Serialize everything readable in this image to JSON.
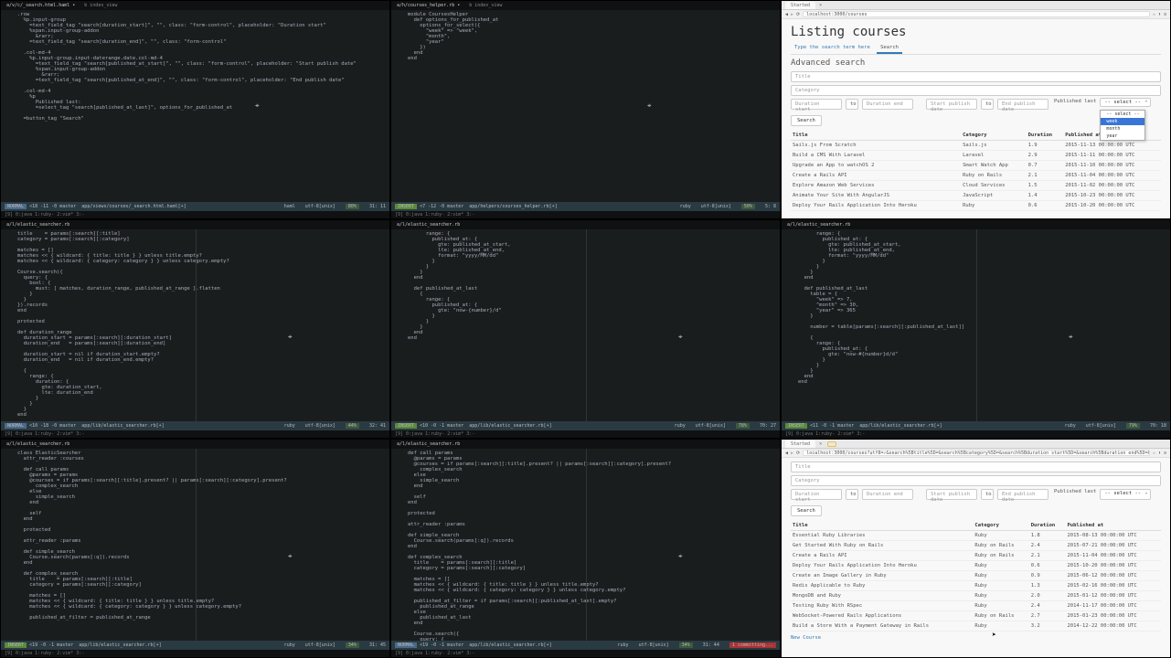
{
  "panes": {
    "p1": {
      "tabs": [
        "a/v/c/_search.html.haml •",
        "b index_view"
      ],
      "tabs_right": [
        "a/h/courses_helper.rb •",
        "b index_view"
      ],
      "code_left": ".row\n  %p.input-group\n    =text_field_tag \"search[duration_start]\", \"\", class: \"form-control\", placeholder: \"Duration start\"\n    %span.input-group-addon\n      &rarr;\n    =text_field_tag \"search[duration_end]\", \"\", class: \"form-control\"\n\n  .col-md-4\n    %p.input-group.input-daterange.date.col-md-4\n      =text_field_tag \"search[published_at_start]\", \"\", class: \"form-control\", placeholder: \"Start publish date\"\n      %span.input-group-addon\n        &rarr;\n      =text_field_tag \"search[published_at_end]\", \"\", class: \"form-control\", placeholder: \"End publish date\"\n\n  .col-md-4\n    %p\n      Published last:\n      =select_tag \"search[published_at_last]\", options_for_published_at\n\n  =button_tag \"Search\"",
      "code_right": "module CoursesHelper\n  def options_for_published_at\n    options_for_select({\n      \"week\" => \"week\",\n      \"month\",\n      \"year\"\n    })\n  end\nend",
      "status_left": {
        "mode": "NORMAL",
        "branch": "<18 -11 -0 master",
        "file": "app/views/courses/_search.html.haml[+]",
        "lang": "haml",
        "enc": "utf-8[unix]",
        "pct": "80%",
        "pos": "31: 11"
      },
      "status_right": {
        "mode": "INSERT",
        "branch": "<7 -12 -0 master",
        "file": "app/helpers/courses_helper.rb[+]",
        "lang": "ruby",
        "enc": "utf-8[unix]",
        "pct": "50%",
        "pos": "5:  8"
      },
      "cmdline": "[9] 0:java  1:ruby- 2:vim* 3:-"
    },
    "p3_browser": {
      "tab": "Started",
      "url": "localhost:3000/courses",
      "heading": "Listing courses",
      "search_hint": "Type the search term here",
      "search_tab": "Search",
      "adv": "Advanced search",
      "fields": {
        "title": "Title",
        "category": "Category",
        "dstart": "Duration start",
        "dend": "Duration end",
        "pstart": "Start publish date",
        "pend": "End publish date",
        "pub_label": "Published last",
        "select": "-- select --",
        "to": "to"
      },
      "dropdown": [
        "-- select --",
        "week",
        "month",
        "year"
      ],
      "search_btn": "Search",
      "columns": [
        "Title",
        "Category",
        "Duration",
        "Published at"
      ],
      "rows": [
        [
          "Sails.js From Scratch",
          "Sails.js",
          "1.9",
          "2015-11-13 00:00:00 UTC"
        ],
        [
          "Build a CMS With Laravel",
          "Laravel",
          "2.9",
          "2015-11-11 00:00:00 UTC"
        ],
        [
          "Upgrade an App to watchOS 2",
          "Smart Watch App",
          "0.7",
          "2015-11-10 00:00:00 UTC"
        ],
        [
          "Create a Rails API",
          "Ruby on Rails",
          "2.1",
          "2015-11-04 00:00:00 UTC"
        ],
        [
          "Explore Amazon Web Services",
          "Cloud Services",
          "1.5",
          "2015-11-02 00:00:00 UTC"
        ],
        [
          "Animate Your Site With AngularJS",
          "JavaScript",
          "1.4",
          "2015-10-23 00:00:00 UTC"
        ],
        [
          "Deploy Your Rails Application Into Heroku",
          "Ruby",
          "0.6",
          "2015-10-20 00:00:00 UTC"
        ]
      ]
    },
    "p4": {
      "tab": "a/l/elastic_searcher.rb",
      "code": "title    = params[:search][:title]\ncategory = params[:search][:category]\n\nmatches = []\nmatches << { wildcard: { title: title } } unless title.empty?\nmatches << { wildcard: { category: category } } unless category.empty?\n\nCourse.search({\n  query: {\n    bool: {\n      must: [ matches, duration_range, published_at_range ].flatten\n    }\n  }\n}).records\nend\n\nprotected\n\ndef duration_range\n  duration_start = params[:search][:duration_start]\n  duration_end   = params[:search][:duration_end]\n\n  duration_start = nil if duration_start.empty?\n  duration_end   = nil if duration_end.empty?\n\n  {\n    range: {\n      duration: {\n        gte: duration_start,\n        lte: duration_end\n      }\n    }\n  }\nend\n\ndef published_at_range",
      "status": {
        "mode": "NORMAL",
        "branch": "<10 -18 -0 master",
        "file": "app/lib/elastic_searcher.rb[+]",
        "lang": "ruby",
        "enc": "utf-8[unix]",
        "pct": "44%",
        "pos": "32: 41"
      },
      "cmdline": "[9] 0:java  1:ruby- 2:vim* 3:-"
    },
    "p5": {
      "tab": "a/l/elastic_searcher.rb",
      "code": "      range: {\n        published_at: {\n          gte: published_at_start,\n          lte: published_at_end,\n          format: \"yyyy/MM/dd\"\n        }\n      }\n    }\n  end\n\n  def published_at_last\n    {\n      range: {\n        published_at: {\n          gte: \"now-{number}/d\"\n        }\n      }\n    }\n  end\nend",
      "status": {
        "mode": "INSERT",
        "branch": "<10 -0 -1 master",
        "file": "app/lib/elastic_searcher.rb[+]",
        "lang": "ruby",
        "enc": "utf-8[unix]",
        "pct": "78%",
        "pos": "70: 27"
      },
      "cmdline": "[9] 0:java  1:ruby- 2:vim* 3:-"
    },
    "p6": {
      "tab": "a/l/elastic_searcher.rb",
      "code": "      range: {\n        published_at: {\n          gte: published_at_start,\n          lte: published_at_end,\n          format: \"yyyy/MM/dd\"\n        }\n      }\n    }\n  end\n\n  def published_at_last\n    table = {\n      \"week\" => 7,\n      \"month\" => 30,\n      \"year\" => 365\n    }\n\n    number = table[params[:search][:published_at_last]]\n\n    {\n      range: {\n        published_at: {\n          gte: \"now-#{number}d/d\"\n        }\n      }\n    }\n  end\nend",
      "status": {
        "mode": "INSERT",
        "branch": "<11 -0 -1 master",
        "file": "app/lib/elastic_searcher.rb[+]",
        "lang": "ruby",
        "enc": "utf-8[unix]",
        "pct": "79%",
        "pos": "70: 18"
      },
      "cmdline": "[9] 0:java  1:ruby- 2:vim* 3:-"
    },
    "p7": {
      "tab": "a/l/elastic_searcher.rb",
      "code": "class ElasticSearcher\n  attr_reader :courses\n\n  def call params\n    @params = params\n    @courses = if params[:search][:title].present? || params[:search][:category].present?\n      complex_search\n    else\n      simple_search\n    end\n\n    self\n  end\n\n  protected\n\n  attr_reader :params\n\n  def simple_search\n    Course.search(params[:q]).records\n  end\n\n  def complex_search\n    title    = params[:search][:title]\n    category = params[:search][:category]\n\n    matches = []\n    matches << { wildcard: { title: title } } unless title.empty?\n    matches << { wildcard: { category: category } } unless category.empty?\n\n    published_at_filter = published_at_range",
      "status": {
        "mode": "INSERT",
        "branch": "<19 -0 -1 master",
        "file": "app/lib/elastic_searcher.rb[+]",
        "lang": "ruby",
        "enc": "utf-8[unix]",
        "pct": "34%",
        "pos": "31: 45"
      },
      "cmdline": "[9] 0:java  1:ruby- 2:vim* 3:-"
    },
    "p8": {
      "tab": "a/l/elastic_searcher.rb",
      "code": "def call params\n  @params = params\n  @courses = if params[:search][:title].present? || params[:search][:category].present?\n    complex_search\n  else\n    simple_search\n  end\n\n  self\nend\n\nprotected\n\nattr_reader :params\n\ndef simple_search\n  Course.search(params[:q]).records\nend\n\ndef complex_search\n  title    = params[:search][:title]\n  category = params[:search][:category]\n\n  matches = []\n  matches << { wildcard: { title: title } } unless title.empty?\n  matches << { wildcard: { category: category } } unless category.empty?\n\n  published_at_filter = if params[:search][:published_at_last].empty?\n    published_at_range\n  else\n    published_at_last\n  end\n\n  Course.search({\n    query: {",
      "status": {
        "mode": "NORMAL",
        "branch": "<19 -0 -1 master",
        "file": "app/lib/elastic_searcher.rb[+]",
        "lang": "ruby",
        "enc": "utf-8[unix]",
        "pct": "34%",
        "pos": "31: 44",
        "warn": "1 committing..."
      },
      "cmdline": "[9] 0:java  1:ruby- 2:vim* 3:-"
    },
    "p9_browser": {
      "tab": "Started",
      "url": "localhost:3000/courses?utf8=✓&search%5Btitle%5D=&search%5Bcategory%5D=&search%5Bduration_start%5D=&search%5Bduration_end%5D=&search%5Bpublished_at_start%5D=&search%5Bpublished_at_end%5D=&search%5Bpublished_at_last%5D=",
      "fields": {
        "title": "Title",
        "category": "Category",
        "dstart": "Duration start",
        "dend": "Duration end",
        "pstart": "Start publish date",
        "pend": "End publish date",
        "pub_label": "Published last",
        "select": "-- select --",
        "to": "to"
      },
      "search_btn": "Search",
      "columns": [
        "Title",
        "Category",
        "Duration",
        "Published at"
      ],
      "rows": [
        [
          "Essential Ruby Libraries",
          "Ruby",
          "1.8",
          "2015-08-13 00:00:00 UTC"
        ],
        [
          "Get Started With Ruby on Rails",
          "Ruby on Rails",
          "2.4",
          "2015-07-21 00:00:00 UTC"
        ],
        [
          "Create a Rails API",
          "Ruby on Rails",
          "2.1",
          "2015-11-04 00:00:00 UTC"
        ],
        [
          "Deploy Your Rails Application Into Heroku",
          "Ruby",
          "0.6",
          "2015-10-20 00:00:00 UTC"
        ],
        [
          "Create an Image Gallery in Ruby",
          "Ruby",
          "0.9",
          "2015-06-12 00:00:00 UTC"
        ],
        [
          "Redis Applicable to Ruby",
          "Ruby",
          "1.3",
          "2015-02-16 00:00:00 UTC"
        ],
        [
          "MongoDB and Ruby",
          "Ruby",
          "2.0",
          "2015-01-12 00:00:00 UTC"
        ],
        [
          "Testing Ruby With RSpec",
          "Ruby",
          "2.4",
          "2014-11-17 00:00:00 UTC"
        ],
        [
          "WebSocket-Powered Rails Applications",
          "Ruby on Rails",
          "2.7",
          "2015-01-23 00:00:00 UTC"
        ],
        [
          "Build a Store With a Payment Gateway in Rails",
          "Ruby",
          "3.2",
          "2014-12-22 00:00:00 UTC"
        ]
      ],
      "new_course": "New Course"
    }
  }
}
